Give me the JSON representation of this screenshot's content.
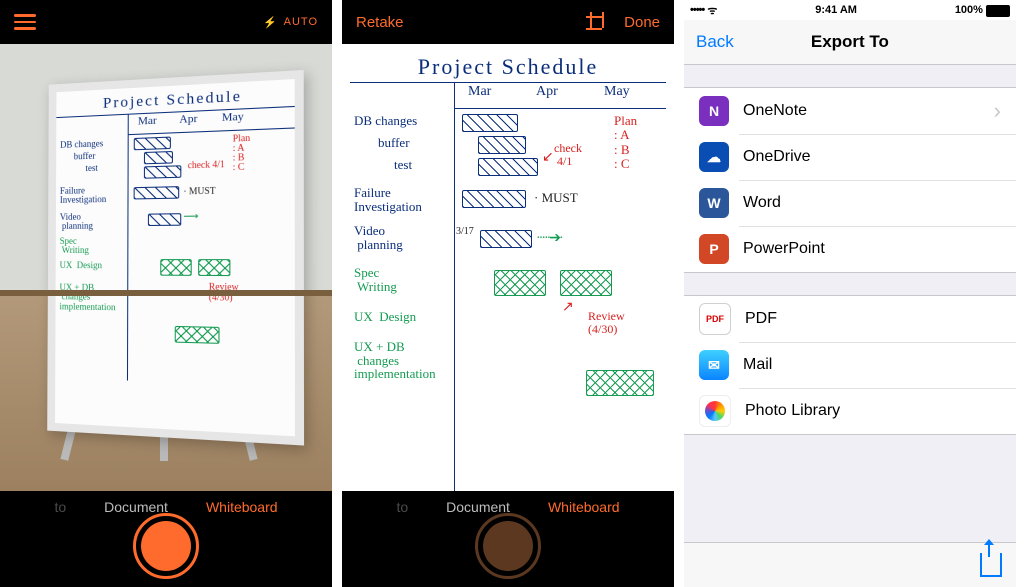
{
  "camera": {
    "flash_mode": "AUTO",
    "modes": {
      "photo_hidden": "to",
      "document": "Document",
      "whiteboard": "Whiteboard"
    }
  },
  "preview": {
    "retake": "Retake",
    "done": "Done"
  },
  "whiteboard": {
    "title": "Project  Schedule",
    "cols": {
      "c1": "Mar",
      "c2": "Apr",
      "c3": "May"
    },
    "rows": {
      "r1": "DB changes",
      "r2": "buffer",
      "r3": "test",
      "r4": "Failure\nInvestigation",
      "r5": "Video\n planning",
      "r6": "Spec\n Writing",
      "r7": "UX  Design",
      "r8": "UX + DB\n changes\nimplementation"
    },
    "annot": {
      "plan": "Plan\n: A\n: B\n: C",
      "check": "check\n 4/1",
      "must": "· MUST",
      "threeseven": "3/17",
      "review": "Review\n(4/30)"
    }
  },
  "ios": {
    "status": {
      "carrier": "•••••",
      "time": "9:41 AM",
      "battery": "100%"
    },
    "nav": {
      "back": "Back",
      "title": "Export To"
    },
    "g1": {
      "onenote": "OneNote",
      "onedrive": "OneDrive",
      "word": "Word",
      "powerpoint": "PowerPoint"
    },
    "g2": {
      "pdf": "PDF",
      "mail": "Mail",
      "photos": "Photo Library"
    }
  }
}
